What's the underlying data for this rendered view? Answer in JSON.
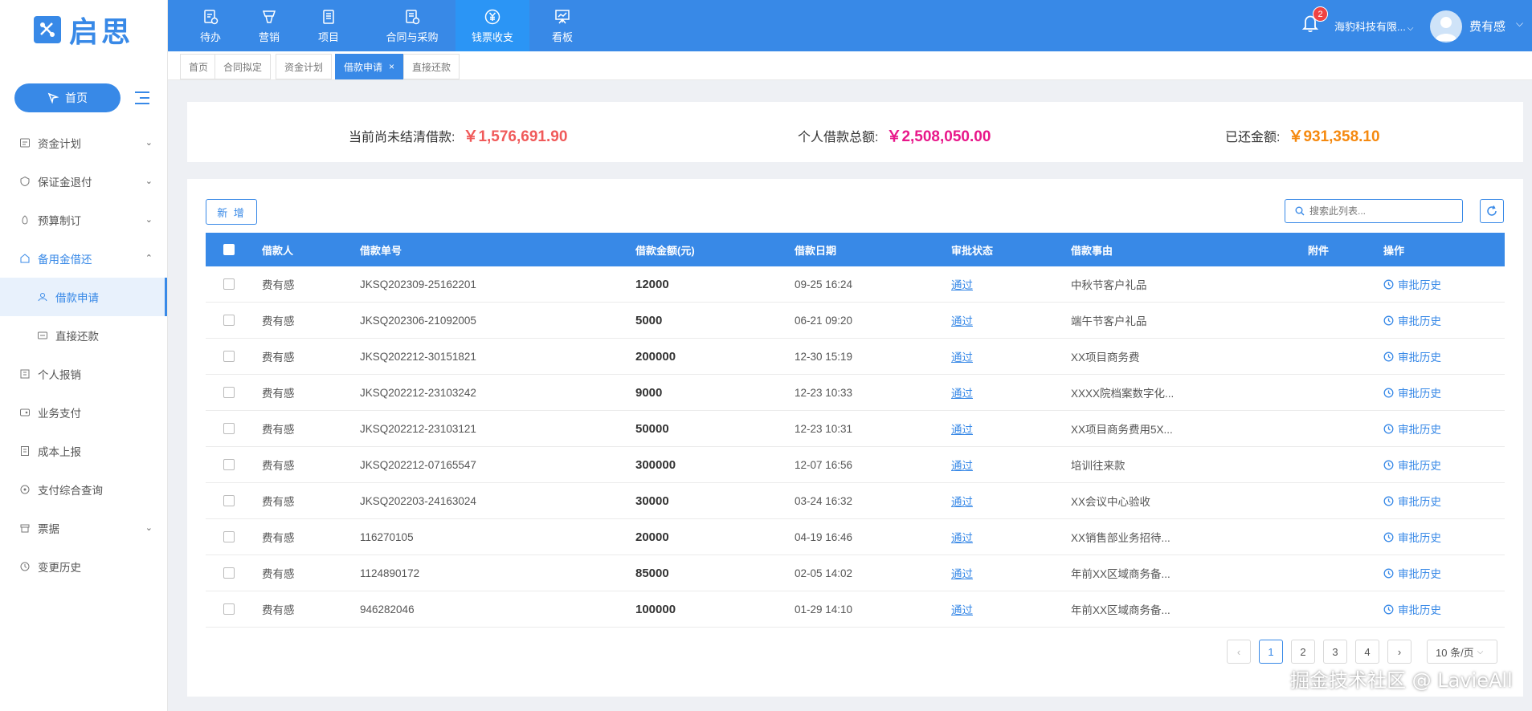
{
  "logo": {
    "text": "启思"
  },
  "sidebar": {
    "home_label": "首页",
    "items": [
      {
        "label": "资金计划",
        "icon": "fund-plan-icon",
        "chevron": "⌄"
      },
      {
        "label": "保证金退付",
        "icon": "deposit-icon",
        "chevron": "⌄"
      },
      {
        "label": "预算制订",
        "icon": "budget-icon",
        "chevron": "⌄"
      },
      {
        "label": "备用金借还",
        "icon": "petty-cash-icon",
        "chevron": "⌃"
      },
      {
        "label": "借款申请",
        "icon": "loan-apply-icon"
      },
      {
        "label": "直接还款",
        "icon": "repay-icon"
      },
      {
        "label": "个人报销",
        "icon": "reimburse-icon"
      },
      {
        "label": "业务支付",
        "icon": "payment-icon"
      },
      {
        "label": "成本上报",
        "icon": "cost-report-icon"
      },
      {
        "label": "支付综合查询",
        "icon": "query-icon"
      },
      {
        "label": "票据",
        "icon": "receipt-icon",
        "chevron": "⌄"
      },
      {
        "label": "变更历史",
        "icon": "history-icon"
      }
    ]
  },
  "topnav": {
    "items": [
      {
        "label": "待办",
        "icon": "todo-icon"
      },
      {
        "label": "营销",
        "icon": "marketing-icon"
      },
      {
        "label": "项目",
        "icon": "project-icon"
      },
      {
        "label": "合同与采购",
        "icon": "contract-icon"
      },
      {
        "label": "钱票收支",
        "icon": "finance-icon"
      },
      {
        "label": "看板",
        "icon": "dashboard-icon"
      }
    ],
    "notification_count": "2",
    "company": "海豹科技有限...",
    "username": "费有感"
  },
  "tabs": [
    {
      "label": "首页"
    },
    {
      "label": "合同拟定"
    },
    {
      "label": "资金计划"
    },
    {
      "label": "借款申请",
      "close": "×"
    },
    {
      "label": "直接还款"
    }
  ],
  "summary": {
    "unsettled_label": "当前尚未结清借款:",
    "unsettled_value": "￥1,576,691.90",
    "total_label": "个人借款总额:",
    "total_value": "￥2,508,050.00",
    "repaid_label": "已还金额:",
    "repaid_value": "￥931,358.10",
    "colors": {
      "unsettled": "#f05a5a",
      "total": "#e8178a",
      "repaid": "#f5890f"
    }
  },
  "toolbar": {
    "add_label": "新 增",
    "search_placeholder": "搜索此列表..."
  },
  "table": {
    "headers": [
      "借款人",
      "借款单号",
      "借款金额(元)",
      "借款日期",
      "审批状态",
      "借款事由",
      "附件",
      "操作"
    ],
    "rows": [
      {
        "person": "费有感",
        "no": "JKSQ202309-25162201",
        "amount": "12000",
        "date": "09-25 16:24",
        "status": "通过",
        "reason": "中秋节客户礼品",
        "action": "审批历史"
      },
      {
        "person": "费有感",
        "no": "JKSQ202306-21092005",
        "amount": "5000",
        "date": "06-21 09:20",
        "status": "通过",
        "reason": "端午节客户礼品",
        "action": "审批历史"
      },
      {
        "person": "费有感",
        "no": "JKSQ202212-30151821",
        "amount": "200000",
        "date": "12-30 15:19",
        "status": "通过",
        "reason": "XX项目商务费",
        "action": "审批历史"
      },
      {
        "person": "费有感",
        "no": "JKSQ202212-23103242",
        "amount": "9000",
        "date": "12-23 10:33",
        "status": "通过",
        "reason": "XXXX院档案数字化...",
        "action": "审批历史"
      },
      {
        "person": "费有感",
        "no": "JKSQ202212-23103121",
        "amount": "50000",
        "date": "12-23 10:31",
        "status": "通过",
        "reason": "XX项目商务费用5X...",
        "action": "审批历史"
      },
      {
        "person": "费有感",
        "no": "JKSQ202212-07165547",
        "amount": "300000",
        "date": "12-07 16:56",
        "status": "通过",
        "reason": "培训往来款",
        "action": "审批历史"
      },
      {
        "person": "费有感",
        "no": "JKSQ202203-24163024",
        "amount": "30000",
        "date": "03-24 16:32",
        "status": "通过",
        "reason": "XX会议中心验收",
        "action": "审批历史"
      },
      {
        "person": "费有感",
        "no": "116270105",
        "amount": "20000",
        "date": "04-19 16:46",
        "status": "通过",
        "reason": "XX销售部业务招待...",
        "action": "审批历史"
      },
      {
        "person": "费有感",
        "no": "1124890172",
        "amount": "85000",
        "date": "02-05 14:02",
        "status": "通过",
        "reason": "年前XX区域商务备...",
        "action": "审批历史"
      },
      {
        "person": "费有感",
        "no": "946282046",
        "amount": "100000",
        "date": "01-29 14:10",
        "status": "通过",
        "reason": "年前XX区域商务备...",
        "action": "审批历史"
      }
    ]
  },
  "pagination": {
    "prev": "‹",
    "pages": [
      "1",
      "2",
      "3",
      "4"
    ],
    "current": "1",
    "next": "›",
    "page_size": "10 条/页"
  },
  "watermark": "掘金技术社区 @ LavieAll"
}
